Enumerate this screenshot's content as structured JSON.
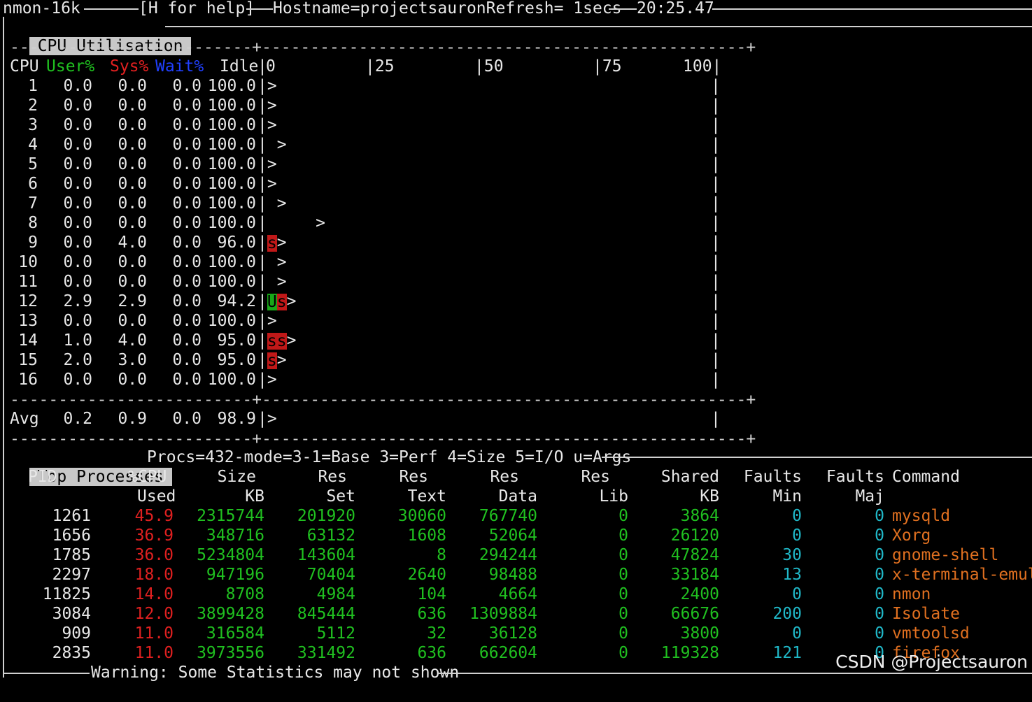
{
  "title": {
    "app": "nmon-16k",
    "help": "[H for help]",
    "hostname": "Hostname=projectsauronRefresh= 1secs",
    "clock": "20:25.47"
  },
  "cpu_section": {
    "label": "CPU Utilisation",
    "dash_line": "-------------------------+--------------------------------------------------+",
    "headers": {
      "cpu": "CPU",
      "user": "User%",
      "sys": "Sys%",
      "wait": "Wait%",
      "idle": "Idle"
    },
    "scale": {
      "s0": "0",
      "s25": "|25",
      "s50": "|50",
      "s75": "|75",
      "s100": "100|"
    },
    "rows": [
      {
        "cpu": "1",
        "user": "0.0",
        "sys": "0.0",
        "wait": "0.0",
        "idle": "100.0",
        "u_blocks": "",
        "s_blocks": "",
        "pad": ""
      },
      {
        "cpu": "2",
        "user": "0.0",
        "sys": "0.0",
        "wait": "0.0",
        "idle": "100.0",
        "u_blocks": "",
        "s_blocks": "",
        "pad": ""
      },
      {
        "cpu": "3",
        "user": "0.0",
        "sys": "0.0",
        "wait": "0.0",
        "idle": "100.0",
        "u_blocks": "",
        "s_blocks": "",
        "pad": ""
      },
      {
        "cpu": "4",
        "user": "0.0",
        "sys": "0.0",
        "wait": "0.0",
        "idle": "100.0",
        "u_blocks": "",
        "s_blocks": "",
        "pad": " "
      },
      {
        "cpu": "5",
        "user": "0.0",
        "sys": "0.0",
        "wait": "0.0",
        "idle": "100.0",
        "u_blocks": "",
        "s_blocks": "",
        "pad": ""
      },
      {
        "cpu": "6",
        "user": "0.0",
        "sys": "0.0",
        "wait": "0.0",
        "idle": "100.0",
        "u_blocks": "",
        "s_blocks": "",
        "pad": ""
      },
      {
        "cpu": "7",
        "user": "0.0",
        "sys": "0.0",
        "wait": "0.0",
        "idle": "100.0",
        "u_blocks": "",
        "s_blocks": "",
        "pad": " "
      },
      {
        "cpu": "8",
        "user": "0.0",
        "sys": "0.0",
        "wait": "0.0",
        "idle": "100.0",
        "u_blocks": "",
        "s_blocks": "",
        "pad": "     "
      },
      {
        "cpu": "9",
        "user": "0.0",
        "sys": "4.0",
        "wait": "0.0",
        "idle": "96.0",
        "u_blocks": "",
        "s_blocks": "s",
        "pad": ""
      },
      {
        "cpu": "10",
        "user": "0.0",
        "sys": "0.0",
        "wait": "0.0",
        "idle": "100.0",
        "u_blocks": "",
        "s_blocks": "",
        "pad": " "
      },
      {
        "cpu": "11",
        "user": "0.0",
        "sys": "0.0",
        "wait": "0.0",
        "idle": "100.0",
        "u_blocks": "",
        "s_blocks": "",
        "pad": " "
      },
      {
        "cpu": "12",
        "user": "2.9",
        "sys": "2.9",
        "wait": "0.0",
        "idle": "94.2",
        "u_blocks": "U",
        "s_blocks": "s",
        "pad": ""
      },
      {
        "cpu": "13",
        "user": "0.0",
        "sys": "0.0",
        "wait": "0.0",
        "idle": "100.0",
        "u_blocks": "",
        "s_blocks": "",
        "pad": ""
      },
      {
        "cpu": "14",
        "user": "1.0",
        "sys": "4.0",
        "wait": "0.0",
        "idle": "95.0",
        "u_blocks": "",
        "s_blocks": "ss",
        "pad": ""
      },
      {
        "cpu": "15",
        "user": "2.0",
        "sys": "3.0",
        "wait": "0.0",
        "idle": "95.0",
        "u_blocks": "",
        "s_blocks": "s",
        "pad": ""
      },
      {
        "cpu": "16",
        "user": "0.0",
        "sys": "0.0",
        "wait": "0.0",
        "idle": "100.0",
        "u_blocks": "",
        "s_blocks": "",
        "pad": ""
      }
    ],
    "avg": {
      "label": "Avg",
      "user": "0.2",
      "sys": "0.9",
      "wait": "0.0",
      "idle": "98.9"
    }
  },
  "proc_section": {
    "label": "Top Processes",
    "info": "Procs=432-mode=3-1=Base 3=Perf 4=Size 5=I/O u=Args",
    "headers1": [
      "PID",
      "%CPU",
      "Size",
      "Res",
      "Res",
      "Res",
      "Res",
      "Shared",
      "Faults",
      "Faults",
      "Command"
    ],
    "headers2": [
      "",
      "Used",
      "KB",
      "Set",
      "Text",
      "Data",
      "Lib",
      "KB",
      "Min",
      "Maj",
      ""
    ],
    "rows": [
      {
        "pid": "1261",
        "cpu": "45.9",
        "size": "2315744",
        "res_set": "201920",
        "res_text": "30060",
        "res_data": "767740",
        "res_lib": "0",
        "shared": "3864",
        "flt_min": "0",
        "flt_maj": "0",
        "cmd": "mysqld"
      },
      {
        "pid": "1656",
        "cpu": "36.9",
        "size": "348716",
        "res_set": "63132",
        "res_text": "1608",
        "res_data": "52064",
        "res_lib": "0",
        "shared": "26120",
        "flt_min": "0",
        "flt_maj": "0",
        "cmd": "Xorg"
      },
      {
        "pid": "1785",
        "cpu": "36.0",
        "size": "5234804",
        "res_set": "143604",
        "res_text": "8",
        "res_data": "294244",
        "res_lib": "0",
        "shared": "47824",
        "flt_min": "30",
        "flt_maj": "0",
        "cmd": "gnome-shell"
      },
      {
        "pid": "2297",
        "cpu": "18.0",
        "size": "947196",
        "res_set": "70404",
        "res_text": "2640",
        "res_data": "98488",
        "res_lib": "0",
        "shared": "33184",
        "flt_min": "13",
        "flt_maj": "0",
        "cmd": "x-terminal-emul"
      },
      {
        "pid": "11825",
        "cpu": "14.0",
        "size": "8708",
        "res_set": "4984",
        "res_text": "104",
        "res_data": "4664",
        "res_lib": "0",
        "shared": "2400",
        "flt_min": "0",
        "flt_maj": "0",
        "cmd": "nmon"
      },
      {
        "pid": "3084",
        "cpu": "12.0",
        "size": "3899428",
        "res_set": "845444",
        "res_text": "636",
        "res_data": "1309884",
        "res_lib": "0",
        "shared": "66676",
        "flt_min": "200",
        "flt_maj": "0",
        "cmd": "Isolate"
      },
      {
        "pid": "909",
        "cpu": "11.0",
        "size": "316584",
        "res_set": "5112",
        "res_text": "32",
        "res_data": "36128",
        "res_lib": "0",
        "shared": "3800",
        "flt_min": "0",
        "flt_maj": "0",
        "cmd": "vmtoolsd"
      },
      {
        "pid": "2835",
        "cpu": "11.0",
        "size": "3973556",
        "res_set": "331492",
        "res_text": "636",
        "res_data": "662604",
        "res_lib": "0",
        "shared": "119328",
        "flt_min": "121",
        "flt_maj": "0",
        "cmd": "firefox"
      }
    ]
  },
  "footer": {
    "warning": "Warning: Some Statistics may not shown"
  },
  "watermark": "CSDN @Projectsauron",
  "colors": {
    "user": "#20c020",
    "sys": "#e02020",
    "wait": "#2040ff",
    "faults": "#20b8c8",
    "command": "#e07020",
    "header_bg": "#c8c8c8"
  }
}
